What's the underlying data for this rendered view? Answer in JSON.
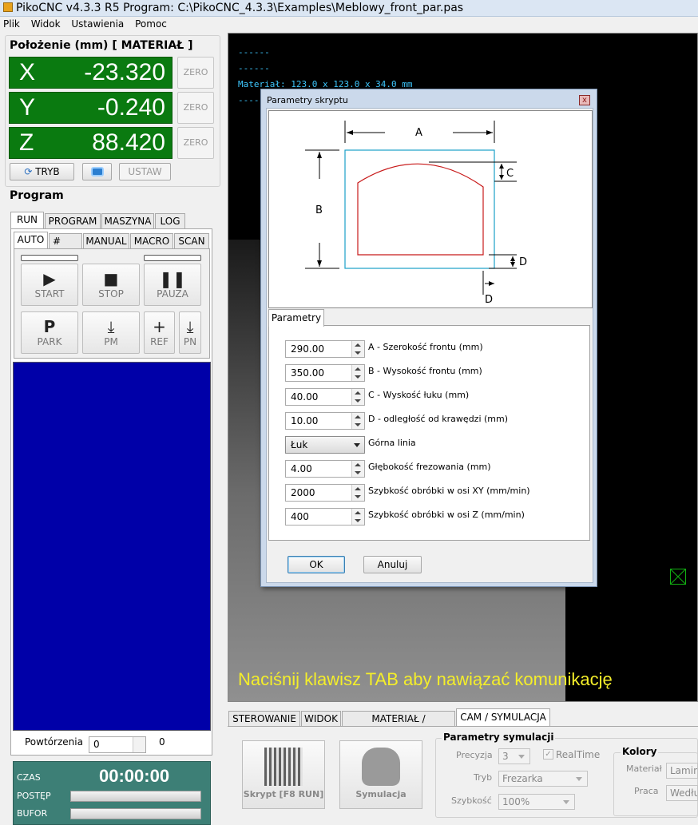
{
  "window": {
    "title": "PikoCNC v4.3.3 R5     Program: C:\\PikoCNC_4.3.3\\Examples\\Meblowy_front_par.pas"
  },
  "menu": [
    "Plik",
    "Widok",
    "Ustawienia",
    "Pomoc"
  ],
  "position": {
    "title": "Położenie (mm) [ MATERIAŁ ]",
    "axes": [
      {
        "label": "X",
        "value": "-23.320",
        "zero": "ZERO"
      },
      {
        "label": "Y",
        "value": "-0.240",
        "zero": "ZERO"
      },
      {
        "label": "Z",
        "value": "88.420",
        "zero": "ZERO"
      }
    ],
    "tryb": "TRYB",
    "ustaw": "USTAW"
  },
  "program": {
    "title": "Program",
    "tabs": [
      "RUN",
      "PROGRAM",
      "MASZYNA",
      "LOG"
    ],
    "subtabs": [
      "AUTO",
      "#",
      "MANUAL",
      "MACRO",
      "SCAN"
    ],
    "buttons": {
      "start": "START",
      "stop": "STOP",
      "pauza": "PAUZA",
      "park": "PARK",
      "pm": "PM",
      "ref": "REF",
      "pn": "PN"
    },
    "repeats_label": "Powtórzenia",
    "repeats_value": "0",
    "repeats_count": "0"
  },
  "status": {
    "czas_label": "CZAS",
    "czas_value": "00:00:00",
    "postep": "POSTĘP",
    "bufor": "BUFOR"
  },
  "canvas": {
    "lines": [
      "------",
      "------",
      "Materiał: 123.0 x 123.0 x 34.0 mm",
      "------"
    ],
    "message": "Naciśnij klawisz TAB aby nawiązać komunikację"
  },
  "bottom": {
    "tabs": [
      "STEROWANIE",
      "WIDOK",
      "MATERIAŁ / NARZĘDZIA",
      "CAM / SYMULACJA"
    ],
    "skrypt": "Skrypt [F8 RUN]",
    "symulacja": "Symulacja",
    "sim_title": "Parametry symulacji",
    "precyzja_label": "Precyzja",
    "precyzja_value": "3",
    "realtime": "RealTime",
    "tryb_label": "Tryb",
    "tryb_value": "Frezarka",
    "szybkosc_label": "Szybkość",
    "szybkosc_value": "100%",
    "kolory_title": "Kolory",
    "material_label": "Materiał",
    "material_value": "Lamin",
    "praca_label": "Praca",
    "praca_value": "Wedłu"
  },
  "dialog": {
    "title": "Parametry skryptu",
    "close": "x",
    "diagram_labels": {
      "a": "A",
      "b": "B",
      "c": "C",
      "d1": "D",
      "d2": "D"
    },
    "tab": "Parametry",
    "params": [
      {
        "value": "290.00",
        "label": "A - Szerokość frontu (mm)"
      },
      {
        "value": "350.00",
        "label": "B - Wysokość  frontu (mm)"
      },
      {
        "value": "40.00",
        "label": "C - Wyskość łuku (mm)"
      },
      {
        "value": "10.00",
        "label": "D - odległość od krawędzi (mm)"
      },
      {
        "value": "Łuk",
        "label": "Górna linia"
      },
      {
        "value": "4.00",
        "label": "Głębokość frezowania (mm)"
      },
      {
        "value": "2000",
        "label": "Szybkość obróbki w osi XY (mm/min)"
      },
      {
        "value": "400",
        "label": "Szybkość obróbki w osi Z (mm/min)"
      }
    ],
    "ok": "OK",
    "cancel": "Anuluj"
  },
  "colors": {
    "axis_bg": "#0a7a10",
    "program_bg": "#0000a8",
    "status_bg": "#3d7f76",
    "canvas_text": "#3ec8ff",
    "message": "#f4ee2a"
  }
}
